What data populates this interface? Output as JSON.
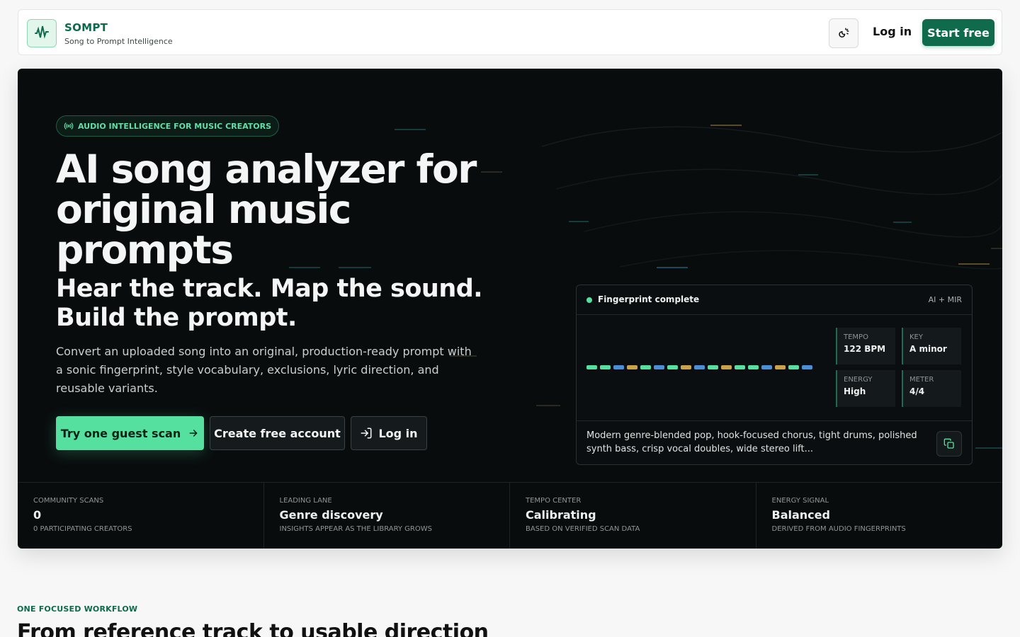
{
  "header": {
    "brand": "SOMPT",
    "tagline": "Song to Prompt Intelligence",
    "login_label": "Log in",
    "start_label": "Start free"
  },
  "hero": {
    "badge": "AUDIO INTELLIGENCE FOR MUSIC CREATORS",
    "title": "AI song analyzer for original music prompts",
    "subtitle": "Hear the track. Map the sound. Build the prompt.",
    "description": "Convert an uploaded song into an original, production-ready prompt with a sonic fingerprint, style vocabulary, exclusions, lyric direction, and reusable variants.",
    "buttons": {
      "guest_scan": "Try one guest scan",
      "create_account": "Create free account",
      "login": "Log in"
    }
  },
  "fingerprint_card": {
    "status": "Fingerprint complete",
    "tag": "AI + MIR",
    "metrics": [
      {
        "label": "TEMPO",
        "value": "122 BPM"
      },
      {
        "label": "KEY",
        "value": "A minor"
      },
      {
        "label": "ENERGY",
        "value": "High"
      },
      {
        "label": "METER",
        "value": "4/4"
      }
    ],
    "prompt_text": "Modern genre-blended pop, hook-focused chorus, tight drums, polished synth bass, crisp vocal doubles, wide stereo lift...",
    "waveform_colors": [
      "#55e0a0",
      "#55e0a0",
      "#4a90d9",
      "#c9a24a",
      "#55e0a0",
      "#4a90d9",
      "#55e0a0",
      "#c9a24a",
      "#4a90d9",
      "#55e0a0",
      "#c9a24a",
      "#55e0a0",
      "#55e0a0",
      "#4a90d9",
      "#c9a24a",
      "#55e0a0",
      "#4a90d9"
    ]
  },
  "stats": [
    {
      "label": "COMMUNITY SCANS",
      "value": "0",
      "sub": "0 PARTICIPATING CREATORS"
    },
    {
      "label": "LEADING LANE",
      "value": "Genre discovery",
      "sub": "INSIGHTS APPEAR AS THE LIBRARY GROWS"
    },
    {
      "label": "TEMPO CENTER",
      "value": "Calibrating",
      "sub": "BASED ON VERIFIED SCAN DATA"
    },
    {
      "label": "ENERGY SIGNAL",
      "value": "Balanced",
      "sub": "DERIVED FROM AUDIO FINGERPRINTS"
    }
  ],
  "workflow": {
    "eyebrow": "ONE FOCUSED WORKFLOW",
    "title": "From reference track to usable direction"
  },
  "icons": {
    "logo": "waveform-icon",
    "theme": "theme-toggle-icon",
    "badge": "broadcast-icon",
    "arrow": "arrow-right-icon",
    "login": "login-icon",
    "copy": "copy-icon"
  },
  "colors": {
    "brand_green": "#0f6b4c",
    "accent_green": "#55e0a0",
    "hero_bg": "#090c0d"
  }
}
